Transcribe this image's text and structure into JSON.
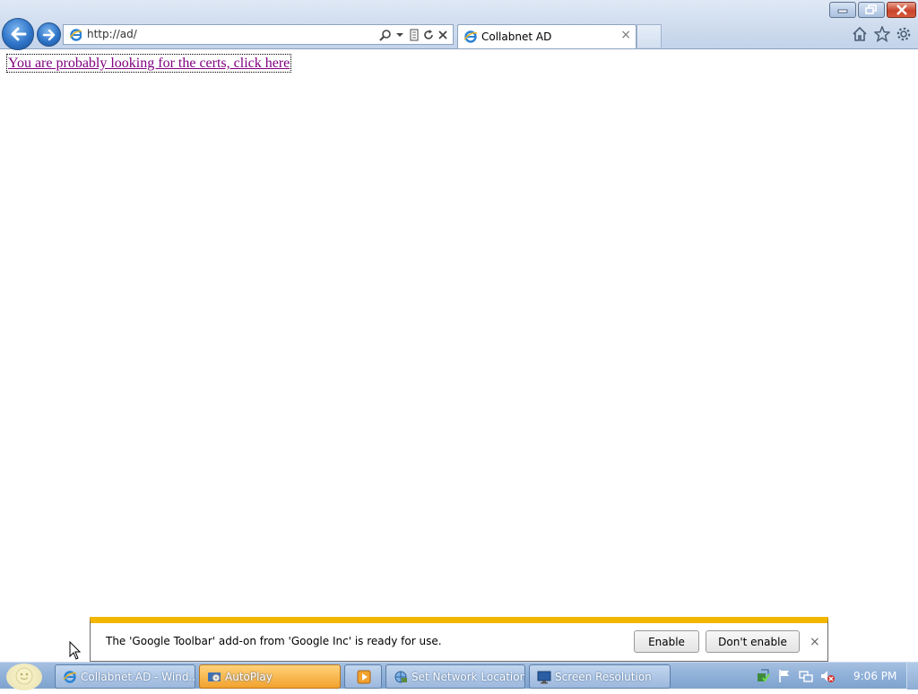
{
  "browser": {
    "address": {
      "value": "http://ad/"
    },
    "tab": {
      "title": "Collabnet AD"
    }
  },
  "page": {
    "link_text": "You are probably looking for the certs, click here"
  },
  "notification": {
    "message": "The 'Google Toolbar' add-on from 'Google Inc' is ready for use.",
    "enable_label": "Enable",
    "dont_enable_label": "Don't enable",
    "close_label": "×"
  },
  "taskbar": {
    "items": [
      {
        "label": "Collabnet AD - Wind...",
        "icon": "ie-icon"
      },
      {
        "label": "AutoPlay",
        "icon": "autoplay-icon"
      },
      {
        "label": "",
        "icon": "media-player-icon"
      },
      {
        "label": "Set Network Location",
        "icon": "network-icon"
      },
      {
        "label": "Screen Resolution",
        "icon": "display-icon"
      }
    ],
    "clock": "9:06 PM"
  },
  "colors": {
    "link_visited": "#800080",
    "notification_accent": "#f3b600",
    "close_button": "#c8442b"
  }
}
